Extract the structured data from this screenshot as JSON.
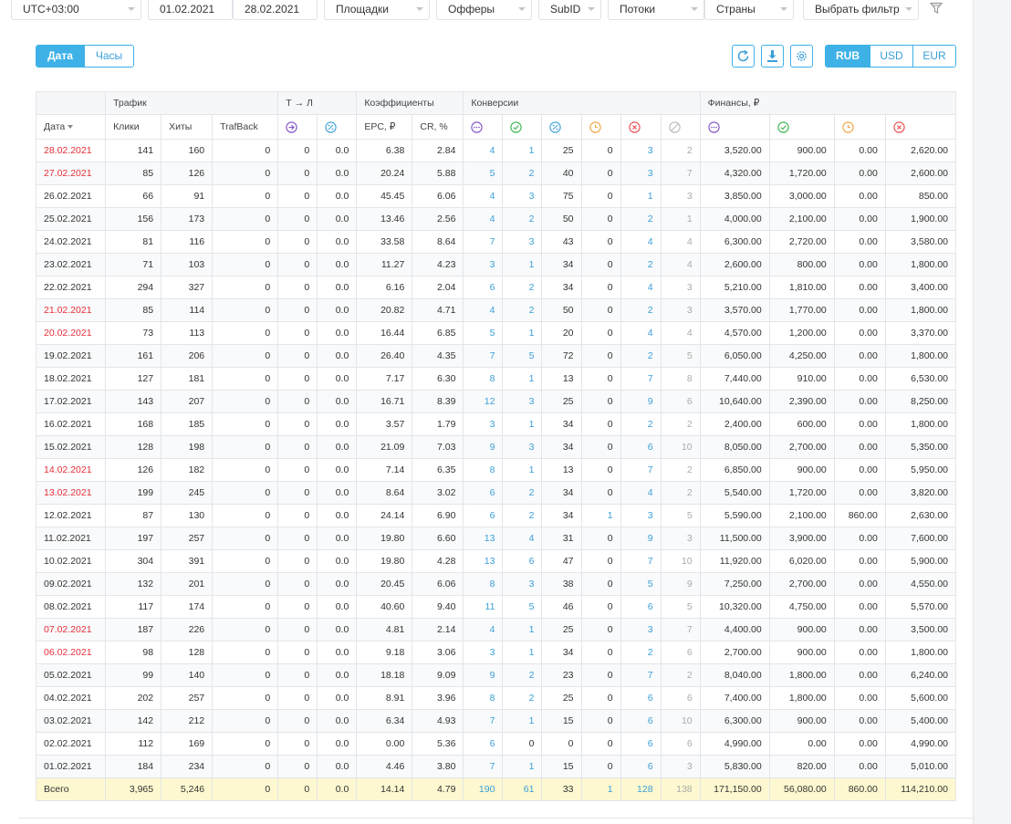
{
  "filters": {
    "timezone": "UTC+03:00",
    "date_from": "01.02.2021",
    "date_to": "28.02.2021",
    "platforms": "Площадки",
    "offers": "Офферы",
    "subid": "SubID",
    "streams": "Потоки",
    "countries": "Страны",
    "choose_filter": "Выбрать фильтр"
  },
  "grouping": {
    "date": "Дата",
    "hours": "Часы"
  },
  "currency": {
    "rub": "RUB",
    "usd": "USD",
    "eur": "EUR",
    "active": "RUB"
  },
  "table": {
    "groups": {
      "traffic": "Трафик",
      "tl": "Т → Л",
      "coef": "Коэффициенты",
      "conv": "Конверсии",
      "fin": "Финансы, ₽"
    },
    "headers": {
      "date": "Дата",
      "clicks": "Клики",
      "hits": "Хиты",
      "trafback": "TrafBack",
      "epc": "EPC, ₽",
      "cr": "CR, %"
    },
    "rows": [
      [
        "28.02.2021",
        "141",
        "160",
        "0",
        "0",
        "0.0",
        "6.38",
        "2.84",
        "4",
        "1",
        "25",
        "0",
        "3",
        "2",
        "3,520.00",
        "900.00",
        "0.00",
        "2,620.00"
      ],
      [
        "27.02.2021",
        "85",
        "126",
        "0",
        "0",
        "0.0",
        "20.24",
        "5.88",
        "5",
        "2",
        "40",
        "0",
        "3",
        "7",
        "4,320.00",
        "1,720.00",
        "0.00",
        "2,600.00"
      ],
      [
        "26.02.2021",
        "66",
        "91",
        "0",
        "0",
        "0.0",
        "45.45",
        "6.06",
        "4",
        "3",
        "75",
        "0",
        "1",
        "3",
        "3,850.00",
        "3,000.00",
        "0.00",
        "850.00"
      ],
      [
        "25.02.2021",
        "156",
        "173",
        "0",
        "0",
        "0.0",
        "13.46",
        "2.56",
        "4",
        "2",
        "50",
        "0",
        "2",
        "1",
        "4,000.00",
        "2,100.00",
        "0.00",
        "1,900.00"
      ],
      [
        "24.02.2021",
        "81",
        "116",
        "0",
        "0",
        "0.0",
        "33.58",
        "8.64",
        "7",
        "3",
        "43",
        "0",
        "4",
        "4",
        "6,300.00",
        "2,720.00",
        "0.00",
        "3,580.00"
      ],
      [
        "23.02.2021",
        "71",
        "103",
        "0",
        "0",
        "0.0",
        "11.27",
        "4.23",
        "3",
        "1",
        "34",
        "0",
        "2",
        "4",
        "2,600.00",
        "800.00",
        "0.00",
        "1,800.00"
      ],
      [
        "22.02.2021",
        "294",
        "327",
        "0",
        "0",
        "0.0",
        "6.16",
        "2.04",
        "6",
        "2",
        "34",
        "0",
        "4",
        "3",
        "5,210.00",
        "1,810.00",
        "0.00",
        "3,400.00"
      ],
      [
        "21.02.2021",
        "85",
        "114",
        "0",
        "0",
        "0.0",
        "20.82",
        "4.71",
        "4",
        "2",
        "50",
        "0",
        "2",
        "3",
        "3,570.00",
        "1,770.00",
        "0.00",
        "1,800.00"
      ],
      [
        "20.02.2021",
        "73",
        "113",
        "0",
        "0",
        "0.0",
        "16.44",
        "6.85",
        "5",
        "1",
        "20",
        "0",
        "4",
        "4",
        "4,570.00",
        "1,200.00",
        "0.00",
        "3,370.00"
      ],
      [
        "19.02.2021",
        "161",
        "206",
        "0",
        "0",
        "0.0",
        "26.40",
        "4.35",
        "7",
        "5",
        "72",
        "0",
        "2",
        "5",
        "6,050.00",
        "4,250.00",
        "0.00",
        "1,800.00"
      ],
      [
        "18.02.2021",
        "127",
        "181",
        "0",
        "0",
        "0.0",
        "7.17",
        "6.30",
        "8",
        "1",
        "13",
        "0",
        "7",
        "8",
        "7,440.00",
        "910.00",
        "0.00",
        "6,530.00"
      ],
      [
        "17.02.2021",
        "143",
        "207",
        "0",
        "0",
        "0.0",
        "16.71",
        "8.39",
        "12",
        "3",
        "25",
        "0",
        "9",
        "6",
        "10,640.00",
        "2,390.00",
        "0.00",
        "8,250.00"
      ],
      [
        "16.02.2021",
        "168",
        "185",
        "0",
        "0",
        "0.0",
        "3.57",
        "1.79",
        "3",
        "1",
        "34",
        "0",
        "2",
        "2",
        "2,400.00",
        "600.00",
        "0.00",
        "1,800.00"
      ],
      [
        "15.02.2021",
        "128",
        "198",
        "0",
        "0",
        "0.0",
        "21.09",
        "7.03",
        "9",
        "3",
        "34",
        "0",
        "6",
        "10",
        "8,050.00",
        "2,700.00",
        "0.00",
        "5,350.00"
      ],
      [
        "14.02.2021",
        "126",
        "182",
        "0",
        "0",
        "0.0",
        "7.14",
        "6.35",
        "8",
        "1",
        "13",
        "0",
        "7",
        "2",
        "6,850.00",
        "900.00",
        "0.00",
        "5,950.00"
      ],
      [
        "13.02.2021",
        "199",
        "245",
        "0",
        "0",
        "0.0",
        "8.64",
        "3.02",
        "6",
        "2",
        "34",
        "0",
        "4",
        "2",
        "5,540.00",
        "1,720.00",
        "0.00",
        "3,820.00"
      ],
      [
        "12.02.2021",
        "87",
        "130",
        "0",
        "0",
        "0.0",
        "24.14",
        "6.90",
        "6",
        "2",
        "34",
        "1",
        "3",
        "5",
        "5,590.00",
        "2,100.00",
        "860.00",
        "2,630.00"
      ],
      [
        "11.02.2021",
        "197",
        "257",
        "0",
        "0",
        "0.0",
        "19.80",
        "6.60",
        "13",
        "4",
        "31",
        "0",
        "9",
        "3",
        "11,500.00",
        "3,900.00",
        "0.00",
        "7,600.00"
      ],
      [
        "10.02.2021",
        "304",
        "391",
        "0",
        "0",
        "0.0",
        "19.80",
        "4.28",
        "13",
        "6",
        "47",
        "0",
        "7",
        "10",
        "11,920.00",
        "6,020.00",
        "0.00",
        "5,900.00"
      ],
      [
        "09.02.2021",
        "132",
        "201",
        "0",
        "0",
        "0.0",
        "20.45",
        "6.06",
        "8",
        "3",
        "38",
        "0",
        "5",
        "9",
        "7,250.00",
        "2,700.00",
        "0.00",
        "4,550.00"
      ],
      [
        "08.02.2021",
        "117",
        "174",
        "0",
        "0",
        "0.0",
        "40.60",
        "9.40",
        "11",
        "5",
        "46",
        "0",
        "6",
        "5",
        "10,320.00",
        "4,750.00",
        "0.00",
        "5,570.00"
      ],
      [
        "07.02.2021",
        "187",
        "226",
        "0",
        "0",
        "0.0",
        "4.81",
        "2.14",
        "4",
        "1",
        "25",
        "0",
        "3",
        "7",
        "4,400.00",
        "900.00",
        "0.00",
        "3,500.00"
      ],
      [
        "06.02.2021",
        "98",
        "128",
        "0",
        "0",
        "0.0",
        "9.18",
        "3.06",
        "3",
        "1",
        "34",
        "0",
        "2",
        "6",
        "2,700.00",
        "900.00",
        "0.00",
        "1,800.00"
      ],
      [
        "05.02.2021",
        "99",
        "140",
        "0",
        "0",
        "0.0",
        "18.18",
        "9.09",
        "9",
        "2",
        "23",
        "0",
        "7",
        "2",
        "8,040.00",
        "1,800.00",
        "0.00",
        "6,240.00"
      ],
      [
        "04.02.2021",
        "202",
        "257",
        "0",
        "0",
        "0.0",
        "8.91",
        "3.96",
        "8",
        "2",
        "25",
        "0",
        "6",
        "6",
        "7,400.00",
        "1,800.00",
        "0.00",
        "5,600.00"
      ],
      [
        "03.02.2021",
        "142",
        "212",
        "0",
        "0",
        "0.0",
        "6.34",
        "4.93",
        "7",
        "1",
        "15",
        "0",
        "6",
        "10",
        "6,300.00",
        "900.00",
        "0.00",
        "5,400.00"
      ],
      [
        "02.02.2021",
        "112",
        "169",
        "0",
        "0",
        "0.0",
        "0.00",
        "5.36",
        "6",
        "0",
        "0",
        "0",
        "6",
        "6",
        "4,990.00",
        "0.00",
        "0.00",
        "4,990.00"
      ],
      [
        "01.02.2021",
        "184",
        "234",
        "0",
        "0",
        "0.0",
        "4.46",
        "3.80",
        "7",
        "1",
        "15",
        "0",
        "6",
        "3",
        "5,830.00",
        "820.00",
        "0.00",
        "5,010.00"
      ]
    ],
    "red_dates": [
      "28.02.2021",
      "27.02.2021",
      "21.02.2021",
      "20.02.2021",
      "14.02.2021",
      "13.02.2021",
      "07.02.2021",
      "06.02.2021"
    ],
    "total": [
      "Всего",
      "3,965",
      "5,246",
      "0",
      "0",
      "0.0",
      "14.14",
      "4.79",
      "190",
      "61",
      "33",
      "1",
      "128",
      "138",
      "171,150.00",
      "56,080.00",
      "860.00",
      "114,210.00"
    ]
  },
  "icons": {
    "tl": [
      "arrow-circle-icon",
      "percent-circle-icon"
    ],
    "conv": [
      "dots-circle-icon",
      "check-circle-icon",
      "percent-circle-icon",
      "clock-circle-icon",
      "cross-circle-icon",
      "slash-circle-icon"
    ],
    "fin": [
      "dots-circle-icon",
      "check-circle-icon",
      "clock-circle-icon",
      "cross-circle-icon"
    ]
  },
  "colors": {
    "accent": "#3eb1e7",
    "red_date": "#e62f3a",
    "link": "#3a9fd8",
    "total_bg": "#fdf8d0",
    "purple": "#7d4fc6",
    "green": "#35b34a",
    "orange": "#f0a23c",
    "red": "#e94a4a",
    "gray": "#b5b8bc"
  }
}
